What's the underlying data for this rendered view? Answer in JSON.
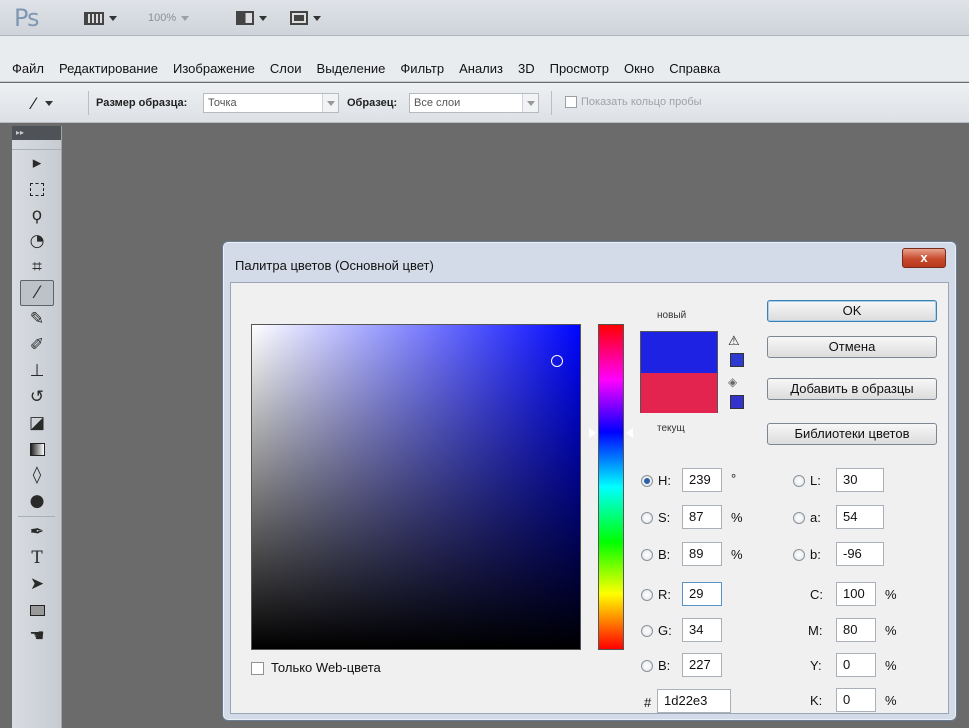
{
  "app": {
    "logo": "Ps",
    "zoom": "100%"
  },
  "menu": [
    "Файл",
    "Редактирование",
    "Изображение",
    "Слои",
    "Выделение",
    "Фильтр",
    "Анализ",
    "3D",
    "Просмотр",
    "Окно",
    "Справка"
  ],
  "options": {
    "sample_size_label": "Размер образца:",
    "sample_size_value": "Точка",
    "sample_label": "Образец:",
    "sample_value": "Все слои",
    "show_ring_label": "Показать кольцо пробы"
  },
  "toolbar": {
    "collapse": "▸▸",
    "tools": [
      "move-icon",
      "marquee-icon",
      "lasso-icon",
      "quick-select-icon",
      "crop-icon",
      "eyedropper-icon",
      "healing-icon",
      "brush-icon",
      "stamp-icon",
      "history-brush-icon",
      "eraser-icon",
      "gradient-icon",
      "blur-icon",
      "dodge-icon",
      "pen-icon",
      "type-icon",
      "path-select-icon",
      "shape-icon",
      "hand-icon"
    ],
    "active": "eyedropper-icon"
  },
  "dialog": {
    "title": "Палитра цветов (Основной цвет)",
    "close_label": "x",
    "new_label": "новый",
    "current_label": "текущ",
    "new_color": "#1d22e3",
    "current_color": "#e2244e",
    "gamut_swatch_color": "#2f3bd0",
    "web_swatch_color": "#3333cc",
    "buttons": {
      "ok": "OK",
      "cancel": "Отмена",
      "add_to_swatches": "Добавить в образцы",
      "color_libraries": "Библиотеки цветов"
    },
    "hsb": [
      {
        "label": "H:",
        "value": "239",
        "unit": "°",
        "selected": true
      },
      {
        "label": "S:",
        "value": "87",
        "unit": "%",
        "selected": false
      },
      {
        "label": "B:",
        "value": "89",
        "unit": "%",
        "selected": false
      }
    ],
    "rgb": [
      {
        "label": "R:",
        "value": "29"
      },
      {
        "label": "G:",
        "value": "34"
      },
      {
        "label": "B:",
        "value": "227"
      }
    ],
    "lab": [
      {
        "label": "L:",
        "value": "30"
      },
      {
        "label": "a:",
        "value": "54"
      },
      {
        "label": "b:",
        "value": "-96"
      }
    ],
    "cmyk": [
      {
        "label": "C:",
        "value": "100",
        "unit": "%"
      },
      {
        "label": "M:",
        "value": "80",
        "unit": "%"
      },
      {
        "label": "Y:",
        "value": "0",
        "unit": "%"
      },
      {
        "label": "K:",
        "value": "0",
        "unit": "%"
      }
    ],
    "hex_label": "#",
    "hex_value": "1d22e3",
    "web_only_label": "Только Web-цвета"
  }
}
